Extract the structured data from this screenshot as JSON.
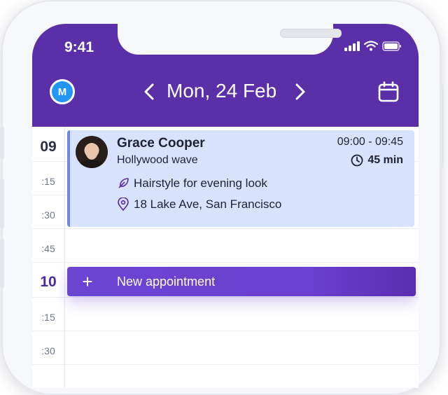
{
  "status_bar": {
    "time": "9:41"
  },
  "header": {
    "user_initial": "M",
    "date": "Mon, 24 Feb",
    "prev_icon": "chevron-left-icon",
    "next_icon": "chevron-right-icon",
    "calendar_icon": "calendar-icon"
  },
  "timeline": {
    "slots": [
      "09",
      ":15",
      ":30",
      ":45",
      "10",
      ":15",
      ":30"
    ]
  },
  "appointment": {
    "client": "Grace Cooper",
    "service": "Hollywood wave",
    "time_range": "09:00 - 09:45",
    "duration": "45 min",
    "note": "Hairstyle for evening look",
    "address": "18 Lake Ave, San Francisco"
  },
  "new_appointment": {
    "label": "New appointment"
  },
  "colors": {
    "header": "#5a2fa8",
    "appointment_bg": "#d7e3fc",
    "appointment_accent": "#6d86ea",
    "button": "#6c45d3"
  }
}
